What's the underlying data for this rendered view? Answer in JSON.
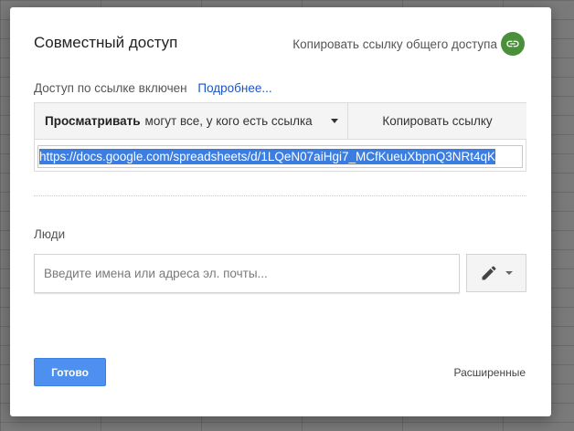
{
  "dialog": {
    "title": "Совместный доступ",
    "copy_public_link_label": "Копировать ссылку общего доступа",
    "copy_public_link_icon": "link-icon",
    "access": {
      "status_text": "Доступ по ссылке включен",
      "learn_more_link": "Подробнее..."
    },
    "permission": {
      "role": "Просматривать",
      "scope_text": "могут все, у кого есть ссылка"
    },
    "copy_link_button": "Копировать ссылку",
    "share_url": "https://docs.google.com/spreadsheets/d/1LQeN07aiHgi7_MCfKueuXbpnQ3NRt4qK",
    "people": {
      "label": "Люди",
      "input_placeholder": "Введите имена или адреса эл. почты...",
      "edit_icon": "pencil-icon"
    },
    "done_button": "Готово",
    "advanced_link": "Расширенные"
  },
  "colors": {
    "link_circle": "#4a8f3a",
    "primary_button": "#4d90f0",
    "link_text": "#1a56c9",
    "selection": "#3b7de0"
  }
}
